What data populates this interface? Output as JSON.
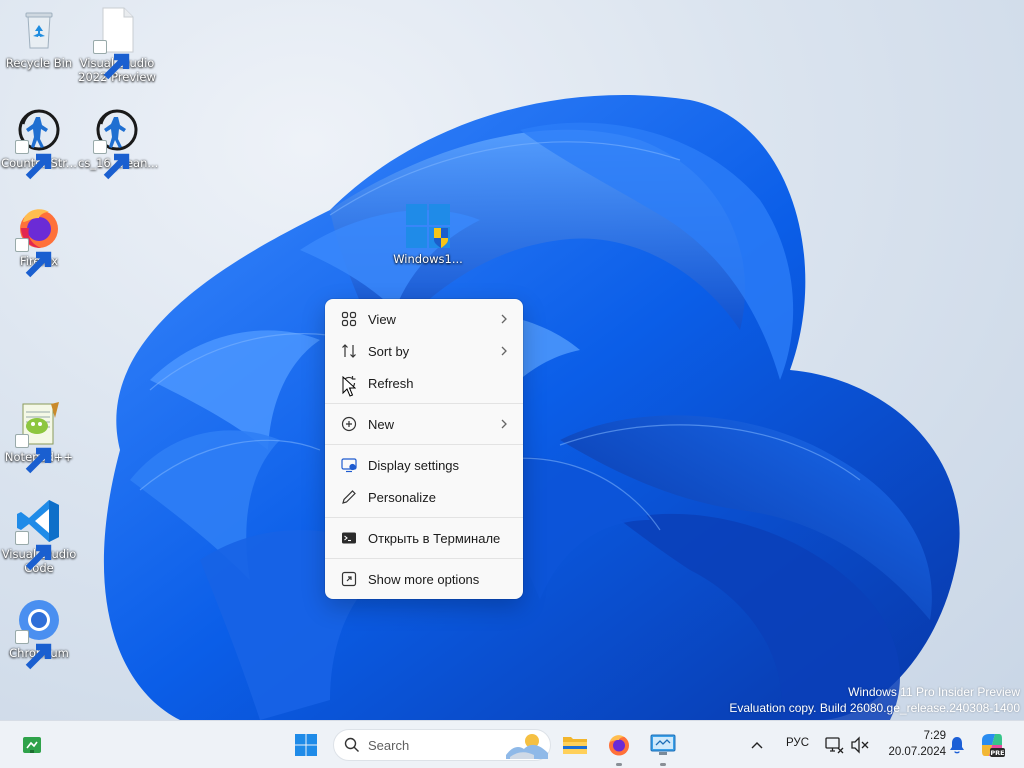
{
  "desktop": {
    "icons": [
      {
        "label": "Recycle Bin",
        "icon": "recycle-bin-icon"
      },
      {
        "label": "Visual Studio 2022 Preview",
        "icon": "file-icon"
      },
      {
        "label": "Counter-Str...",
        "icon": "counter-strike-icon"
      },
      {
        "label": "cs_16_clean...",
        "icon": "counter-strike-icon"
      },
      {
        "label": "Firefox",
        "icon": "firefox-icon"
      },
      {
        "label": "Windows1...",
        "icon": "windows-shield-icon"
      },
      {
        "label": "Notepad++",
        "icon": "notepad-plus-plus-icon"
      },
      {
        "label": "Visual Studio Code",
        "icon": "vscode-icon"
      },
      {
        "label": "Chromium",
        "icon": "chromium-icon"
      }
    ]
  },
  "context_menu": {
    "items": [
      {
        "label": "View",
        "icon": "view-grid-icon",
        "submenu": true
      },
      {
        "label": "Sort by",
        "icon": "sort-icon",
        "submenu": true
      },
      {
        "label": "Refresh",
        "icon": "refresh-icon",
        "submenu": false
      },
      {
        "label": "New",
        "icon": "new-plus-icon",
        "submenu": true
      },
      {
        "label": "Display settings",
        "icon": "display-settings-icon",
        "submenu": false
      },
      {
        "label": "Personalize",
        "icon": "pen-icon",
        "submenu": false
      },
      {
        "label": "Открыть в Терминале",
        "icon": "terminal-icon",
        "submenu": false
      },
      {
        "label": "Show more options",
        "icon": "more-options-icon",
        "submenu": false
      }
    ]
  },
  "watermark": {
    "line1": "Windows 11 Pro Insider Preview",
    "line2": "Evaluation copy. Build 26080.ge_release.240308-1400"
  },
  "taskbar": {
    "search_placeholder": "Search",
    "language": "РУС",
    "time": "7:29",
    "date": "20.07.2024"
  },
  "colors": {
    "accent": "#0a5ad4",
    "menu_bg": "#f9f9f9",
    "taskbar_bg": "#eef2f7"
  }
}
